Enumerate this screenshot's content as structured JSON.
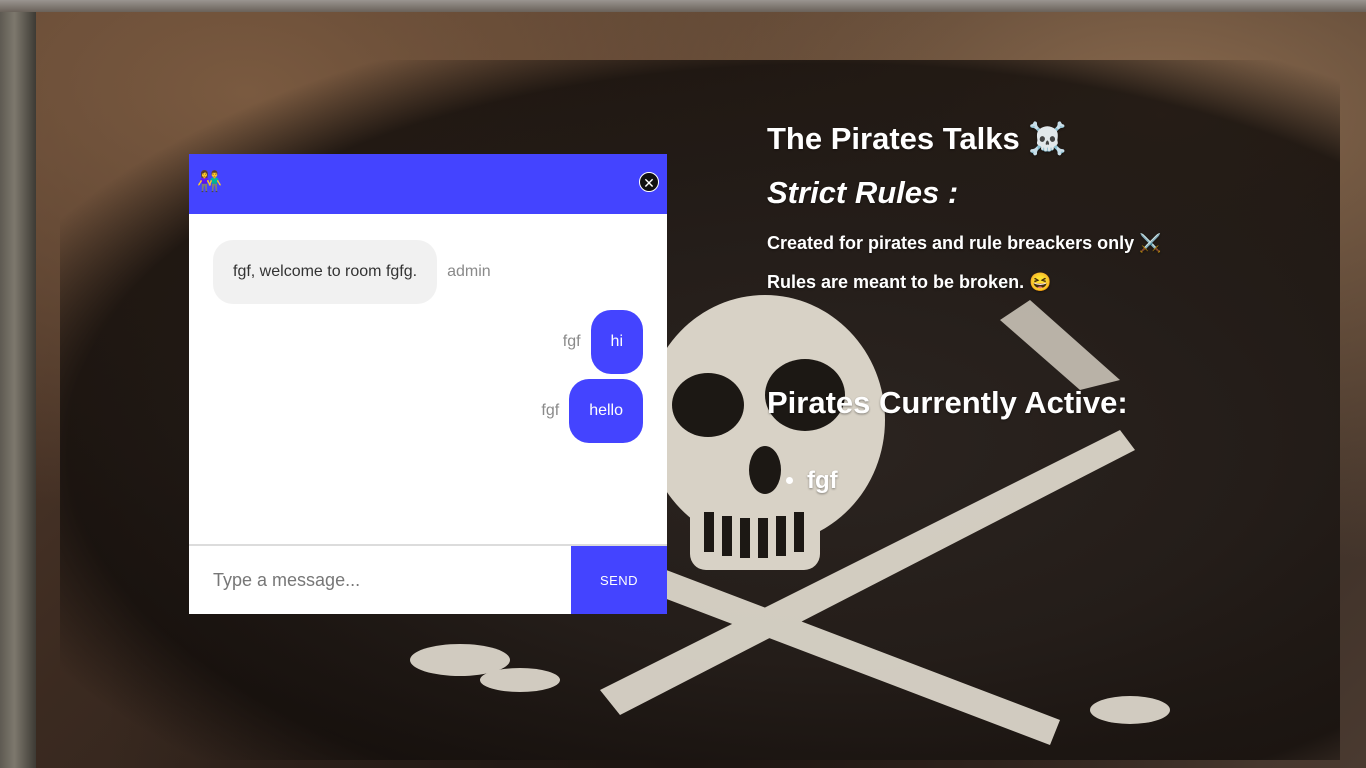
{
  "chat": {
    "header_icon": "👫",
    "close_symbol": "✕",
    "messages": [
      {
        "side": "left",
        "text": "fgf, welcome to room fgfg.",
        "sender": "admin"
      },
      {
        "side": "right",
        "text": "hi",
        "sender": "fgf"
      },
      {
        "side": "right",
        "text": "hello",
        "sender": "fgf"
      }
    ],
    "input_placeholder": "Type a message...",
    "send_label": "SEND"
  },
  "info": {
    "title": "The Pirates Talks ☠️",
    "rules_heading": "Strict Rules :",
    "rule_1": "Created for pirates and rule breackers only ⚔️",
    "rule_2": "Rules are meant to be broken. 😆",
    "active_heading": "Pirates Currently Active:",
    "active_users": [
      "fgf"
    ]
  },
  "colors": {
    "accent": "#4444ff",
    "bubble_other": "#f1f1f1"
  }
}
